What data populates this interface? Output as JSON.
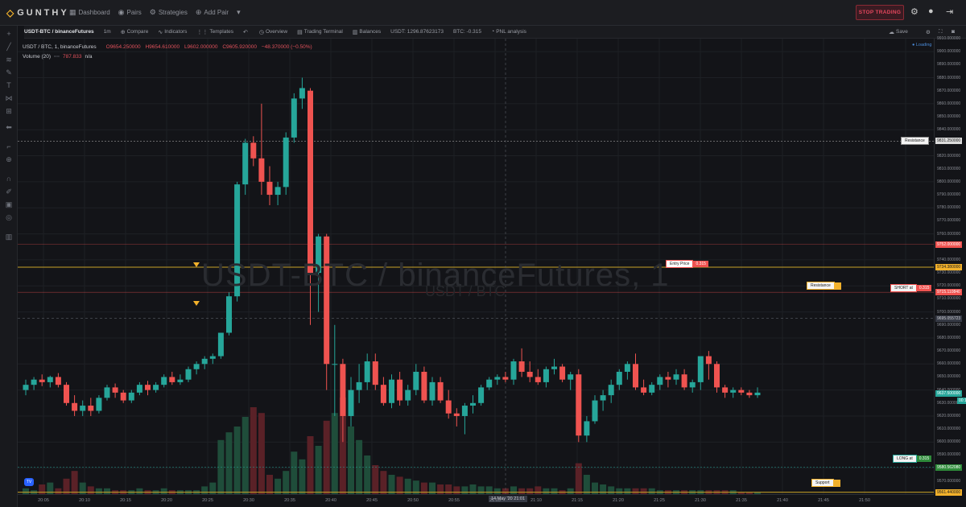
{
  "app": {
    "brand": "GUNTHY",
    "nav": [
      {
        "label": "Dashboard",
        "icon": "dashboard-icon"
      },
      {
        "label": "Pairs",
        "icon": "pairs-icon"
      },
      {
        "label": "Strategies",
        "icon": "strategies-icon"
      },
      {
        "label": "Add Pair",
        "icon": "add-icon"
      }
    ],
    "stop_button": "STOP TRADING",
    "colors": {
      "up": "#26a69a",
      "down": "#ef5350",
      "accent": "#f2b12b",
      "stop": "#e4475d"
    }
  },
  "toolbar": {
    "symbol": "USDT-BTC / binanceFutures",
    "interval": "1m",
    "compare": "Compare",
    "indicators": "Indicators",
    "templates": "Templates",
    "overview": "Overview",
    "terminal": "Trading Terminal",
    "balances": "Balances",
    "usdt_balance": "USDT: 1296.87623173",
    "btc_balance": "BTC: -0.315",
    "pnl": "PNL analysis",
    "save": "Save"
  },
  "legend": {
    "title": "USDT / BTC, 1, binanceFutures",
    "open": "O9654.250000",
    "high": "H9654.610000",
    "low": "L9602.000000",
    "close": "C9605.920000",
    "change": "−48.370000 (−0.50%)",
    "volume_label": "Volume (20)",
    "volume_value": "787.833",
    "volume_na": "n/a"
  },
  "watermark": {
    "main": "USDT-BTC / binanceFutures, 1",
    "sub": "USDT / BTC"
  },
  "loading_text": "Loading",
  "price_axis": {
    "min": 9560,
    "max": 9910,
    "step": 10,
    "decimals": 6
  },
  "time_axis": {
    "labels": [
      "20:05",
      "20:10",
      "20:15",
      "20:20",
      "20:25",
      "20:30",
      "20:35",
      "20:40",
      "20:45",
      "20:50",
      "20:55",
      "21:05",
      "21:10",
      "21:15",
      "21:20",
      "21:25",
      "21:30",
      "21:35",
      "21:40",
      "21:45",
      "21:50"
    ],
    "crosshair_label": "14 May '20   21:01"
  },
  "lines": [
    {
      "name": "Resistance",
      "price": "9831.250000",
      "style": "white-dashed"
    },
    {
      "name": "Entry Price",
      "value_tag": "0.315",
      "price": "9752.000000",
      "style": "red"
    },
    {
      "name": "Resistance",
      "price": "9734.380000",
      "style": "gold"
    },
    {
      "name": "SHORT at",
      "value_tag": "0.315",
      "price": "9715.110840",
      "style": "red"
    },
    {
      "name": "",
      "price": "9695.055723",
      "style": "crosshair"
    },
    {
      "name": "LONG at",
      "value_tag": "0.315",
      "price": "9580.562080",
      "style": "green"
    },
    {
      "name": "Support",
      "price": "9561.440000",
      "style": "gold"
    }
  ],
  "last_price": {
    "price": "9637.500000",
    "countdown": "00:12"
  },
  "chart_data": {
    "type": "candlestick",
    "candles": [
      [
        9640,
        9648,
        9636,
        9644
      ],
      [
        9644,
        9650,
        9640,
        9648
      ],
      [
        9648,
        9652,
        9643,
        9646
      ],
      [
        9646,
        9651,
        9642,
        9650
      ],
      [
        9650,
        9653,
        9642,
        9644
      ],
      [
        9644,
        9646,
        9628,
        9630
      ],
      [
        9630,
        9636,
        9620,
        9624
      ],
      [
        9624,
        9632,
        9620,
        9628
      ],
      [
        9628,
        9634,
        9620,
        9624
      ],
      [
        9624,
        9636,
        9622,
        9634
      ],
      [
        9634,
        9644,
        9632,
        9642
      ],
      [
        9642,
        9645,
        9634,
        9638
      ],
      [
        9638,
        9640,
        9630,
        9632
      ],
      [
        9632,
        9640,
        9630,
        9638
      ],
      [
        9638,
        9646,
        9636,
        9644
      ],
      [
        9644,
        9647,
        9636,
        9640
      ],
      [
        9640,
        9646,
        9638,
        9644
      ],
      [
        9644,
        9652,
        9642,
        9650
      ],
      [
        9650,
        9654,
        9644,
        9646
      ],
      [
        9646,
        9652,
        9644,
        9648
      ],
      [
        9648,
        9658,
        9646,
        9656
      ],
      [
        9656,
        9662,
        9652,
        9660
      ],
      [
        9660,
        9666,
        9656,
        9664
      ],
      [
        9664,
        9668,
        9660,
        9666
      ],
      [
        9666,
        9684,
        9664,
        9684
      ],
      [
        9684,
        9715,
        9682,
        9712
      ],
      [
        9712,
        9800,
        9708,
        9798
      ],
      [
        9798,
        9833,
        9790,
        9830
      ],
      [
        9830,
        9835,
        9812,
        9818
      ],
      [
        9818,
        9860,
        9790,
        9800
      ],
      [
        9800,
        9812,
        9782,
        9790
      ],
      [
        9790,
        9800,
        9782,
        9796
      ],
      [
        9796,
        9838,
        9790,
        9834
      ],
      [
        9834,
        9868,
        9830,
        9864
      ],
      [
        9864,
        9880,
        9856,
        9872
      ],
      [
        9870,
        9872,
        9690,
        9730
      ],
      [
        9730,
        9760,
        9700,
        9758
      ],
      [
        9758,
        9760,
        9640,
        9660
      ],
      [
        9660,
        9690,
        9620,
        9660
      ],
      [
        9660,
        9664,
        9600,
        9620
      ],
      [
        9620,
        9650,
        9612,
        9640
      ],
      [
        9640,
        9660,
        9630,
        9646
      ],
      [
        9646,
        9668,
        9640,
        9662
      ],
      [
        9662,
        9668,
        9640,
        9644
      ],
      [
        9644,
        9650,
        9628,
        9630
      ],
      [
        9630,
        9652,
        9626,
        9648
      ],
      [
        9648,
        9654,
        9628,
        9632
      ],
      [
        9632,
        9644,
        9628,
        9640
      ],
      [
        9640,
        9660,
        9636,
        9654
      ],
      [
        9654,
        9658,
        9630,
        9632
      ],
      [
        9632,
        9650,
        9628,
        9646
      ],
      [
        9646,
        9650,
        9630,
        9632
      ],
      [
        9632,
        9640,
        9618,
        9622
      ],
      [
        9622,
        9626,
        9612,
        9620
      ],
      [
        9620,
        9630,
        9606,
        9628
      ],
      [
        9628,
        9636,
        9622,
        9630
      ],
      [
        9630,
        9644,
        9628,
        9642
      ],
      [
        9642,
        9650,
        9640,
        9648
      ],
      [
        9648,
        9652,
        9644,
        9650
      ],
      [
        9650,
        9654,
        9646,
        9648
      ],
      [
        9648,
        9664,
        9644,
        9662
      ],
      [
        9662,
        9672,
        9650,
        9654
      ],
      [
        9654,
        9662,
        9646,
        9650
      ],
      [
        9650,
        9656,
        9644,
        9646
      ],
      [
        9646,
        9658,
        9642,
        9656
      ],
      [
        9656,
        9664,
        9652,
        9658
      ],
      [
        9658,
        9660,
        9646,
        9648
      ],
      [
        9648,
        9654,
        9640,
        9652
      ],
      [
        9652,
        9656,
        9600,
        9605
      ],
      [
        9605,
        9620,
        9600,
        9616
      ],
      [
        9616,
        9636,
        9614,
        9632
      ],
      [
        9632,
        9640,
        9624,
        9636
      ],
      [
        9636,
        9648,
        9630,
        9644
      ],
      [
        9644,
        9656,
        9640,
        9654
      ],
      [
        9654,
        9662,
        9648,
        9660
      ],
      [
        9660,
        9668,
        9640,
        9642
      ],
      [
        9642,
        9648,
        9636,
        9638
      ],
      [
        9638,
        9646,
        9636,
        9644
      ],
      [
        9644,
        9652,
        9640,
        9650
      ],
      [
        9650,
        9654,
        9642,
        9648
      ],
      [
        9648,
        9656,
        9644,
        9652
      ],
      [
        9652,
        9656,
        9640,
        9642
      ],
      [
        9642,
        9648,
        9638,
        9646
      ],
      [
        9646,
        9660,
        9640,
        9666
      ],
      [
        9666,
        9670,
        9648,
        9660
      ],
      [
        9660,
        9662,
        9638,
        9642
      ],
      [
        9642,
        9644,
        9634,
        9638
      ],
      [
        9638,
        9642,
        9634,
        9640
      ],
      [
        9640,
        9642,
        9636,
        9638
      ],
      [
        9638,
        9640,
        9634,
        9636
      ],
      [
        9636,
        9642,
        9634,
        9638
      ]
    ],
    "volumes": [
      3,
      2,
      5,
      6,
      3,
      8,
      12,
      6,
      4,
      3,
      3,
      2,
      2,
      2,
      3,
      2,
      2,
      3,
      2,
      2,
      2,
      2,
      4,
      6,
      28,
      32,
      35,
      40,
      45,
      42,
      10,
      8,
      12,
      22,
      18,
      30,
      25,
      38,
      42,
      50,
      35,
      28,
      20,
      15,
      12,
      10,
      9,
      8,
      7,
      6,
      6,
      5,
      5,
      4,
      4,
      5,
      4,
      4,
      3,
      3,
      4,
      3,
      3,
      4,
      3,
      3,
      2,
      3,
      16,
      10,
      6,
      5,
      4,
      3,
      3,
      3,
      3,
      3,
      2,
      2,
      2,
      2,
      2,
      2,
      2,
      2,
      2,
      2,
      1,
      1,
      1
    ]
  }
}
